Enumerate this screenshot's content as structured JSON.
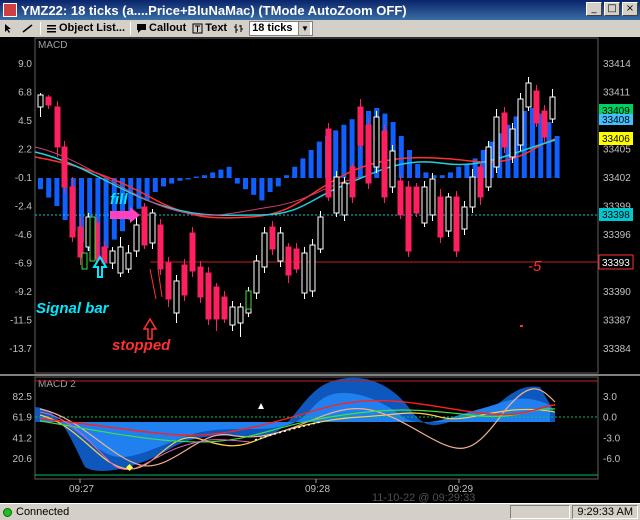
{
  "window": {
    "title": "YMZ22: 18 ticks  (a....Price+BluNaMac)  (TMode AutoZoom OFF)",
    "buttons": [
      "_",
      "□",
      "×"
    ]
  },
  "toolbar": {
    "object_list": "Object List...",
    "callout": "Callout",
    "text": "Text",
    "interval": "18 ticks"
  },
  "price_panel": {
    "indicator_label": "MACD",
    "left_axis": [
      "9.0",
      "6.8",
      "4.5",
      "2.2",
      "-0.1",
      "-2.4",
      "-4.6",
      "-6.9",
      "-9.2",
      "-11.5",
      "-13.7"
    ],
    "right_axis": [
      "33414",
      "33411",
      "33408",
      "33405",
      "33402",
      "33399",
      "33396",
      "33393",
      "33390",
      "33387",
      "33384"
    ],
    "price_tags": [
      {
        "text": "33409",
        "color": "#00d060"
      },
      {
        "text": "33408",
        "color": "#40c0ff"
      },
      {
        "text": "33406",
        "color": "#ffff00"
      },
      {
        "text": "33398",
        "color": "#00c8d0"
      },
      {
        "text": "33393",
        "color": "#000000"
      }
    ],
    "annotations": {
      "fill": "fill",
      "signal_bar": "Signal bar",
      "stopped": "stopped",
      "loss": "-5"
    }
  },
  "macd2_panel": {
    "label": "MACD 2",
    "left_axis": [
      "82.5",
      "61.9",
      "41.2",
      "20.6"
    ],
    "right_axis": [
      "3.0",
      "0.0",
      "-3.0",
      "-6.0"
    ]
  },
  "time_axis": {
    "labels": [
      "09:27",
      "09:28",
      "09:29"
    ],
    "date_watermark": "11-10-22 @ 09:29:33"
  },
  "status": {
    "connection": "Connected",
    "clock": "9:29:33 AM"
  },
  "colors": {
    "bull_candle": "#ffffff",
    "bear_candle": "#ff2060",
    "hist_blue": "#1060ff",
    "annotation_cyan": "#00e8ff",
    "annotation_red": "#ff3030"
  }
}
